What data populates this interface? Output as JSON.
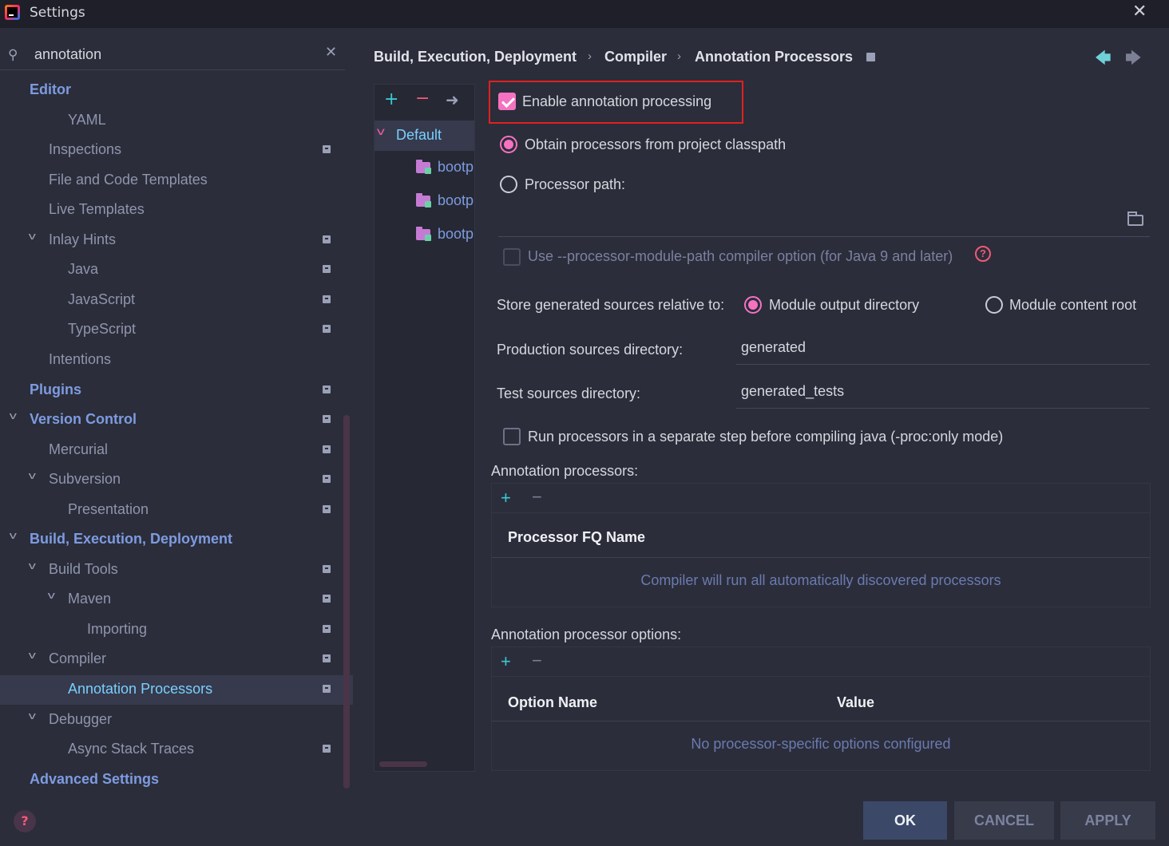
{
  "window": {
    "title": "Settings",
    "close_icon": "✕"
  },
  "search": {
    "value": "annotation"
  },
  "tree": [
    {
      "label": "Editor",
      "level": 0,
      "section": true,
      "chevron": false,
      "badge": false
    },
    {
      "label": "YAML",
      "level": 2,
      "section": false,
      "chevron": false,
      "badge": false
    },
    {
      "label": "Inspections",
      "level": 1,
      "section": false,
      "chevron": false,
      "badge": true
    },
    {
      "label": "File and Code Templates",
      "level": 1,
      "section": false,
      "chevron": false,
      "badge": false
    },
    {
      "label": "Live Templates",
      "level": 1,
      "section": false,
      "chevron": false,
      "badge": false
    },
    {
      "label": "Inlay Hints",
      "level": 1,
      "section": false,
      "chevron": true,
      "badge": true
    },
    {
      "label": "Java",
      "level": 2,
      "section": false,
      "chevron": false,
      "badge": true
    },
    {
      "label": "JavaScript",
      "level": 2,
      "section": false,
      "chevron": false,
      "badge": true
    },
    {
      "label": "TypeScript",
      "level": 2,
      "section": false,
      "chevron": false,
      "badge": true
    },
    {
      "label": "Intentions",
      "level": 1,
      "section": false,
      "chevron": false,
      "badge": false
    },
    {
      "label": "Plugins",
      "level": 0,
      "section": true,
      "chevron": false,
      "badge": true
    },
    {
      "label": "Version Control",
      "level": 0,
      "section": true,
      "chevron": true,
      "badge": true
    },
    {
      "label": "Mercurial",
      "level": 1,
      "section": false,
      "chevron": false,
      "badge": true
    },
    {
      "label": "Subversion",
      "level": 1,
      "section": false,
      "chevron": true,
      "badge": true
    },
    {
      "label": "Presentation",
      "level": 2,
      "section": false,
      "chevron": false,
      "badge": true
    },
    {
      "label": "Build, Execution, Deployment",
      "level": 0,
      "section": true,
      "chevron": true,
      "badge": false
    },
    {
      "label": "Build Tools",
      "level": 1,
      "section": false,
      "chevron": true,
      "badge": true
    },
    {
      "label": "Maven",
      "level": 2,
      "section": false,
      "chevron": true,
      "badge": true
    },
    {
      "label": "Importing",
      "level": 3,
      "section": false,
      "chevron": false,
      "badge": true
    },
    {
      "label": "Compiler",
      "level": 1,
      "section": false,
      "chevron": true,
      "badge": true
    },
    {
      "label": "Annotation Processors",
      "level": 2,
      "section": false,
      "chevron": false,
      "badge": true,
      "selected": true
    },
    {
      "label": "Debugger",
      "level": 1,
      "section": false,
      "chevron": true,
      "badge": false
    },
    {
      "label": "Async Stack Traces",
      "level": 2,
      "section": false,
      "chevron": false,
      "badge": true
    },
    {
      "label": "Advanced Settings",
      "level": 0,
      "section": true,
      "chevron": false,
      "badge": false
    }
  ],
  "breadcrumb": {
    "items": [
      "Build, Execution, Deployment",
      "Compiler",
      "Annotation Processors"
    ],
    "separator": "›"
  },
  "profiles": {
    "default_label": "Default",
    "modules": [
      "bootp",
      "bootp",
      "bootp"
    ]
  },
  "form": {
    "enable_label": "Enable annotation processing",
    "enable_checked": true,
    "obtain_label": "Obtain processors from project classpath",
    "processor_path_label": "Processor path:",
    "processor_path_value": "",
    "module_path_label": "Use --processor-module-path compiler option (for Java 9 and later)",
    "store_label": "Store generated sources relative to:",
    "module_output_label": "Module output directory",
    "module_content_label": "Module content root",
    "production_label": "Production sources directory:",
    "production_value": "generated",
    "test_label": "Test sources directory:",
    "test_value": "generated_tests",
    "run_separate_label": "Run processors in a separate step before compiling java (-proc:only mode)"
  },
  "processors_table": {
    "title": "Annotation processors:",
    "column": "Processor FQ Name",
    "empty": "Compiler will run all automatically discovered processors"
  },
  "options_table": {
    "title": "Annotation processor options:",
    "columns": [
      "Option Name",
      "Value"
    ],
    "empty": "No processor-specific options configured"
  },
  "buttons": {
    "ok": "OK",
    "cancel": "CANCEL",
    "apply": "APPLY"
  },
  "colors": {
    "accent_pink": "#f572c0",
    "accent_cyan": "#39c9d3",
    "selection_text": "#79cfff",
    "highlight_box": "#e02020"
  }
}
